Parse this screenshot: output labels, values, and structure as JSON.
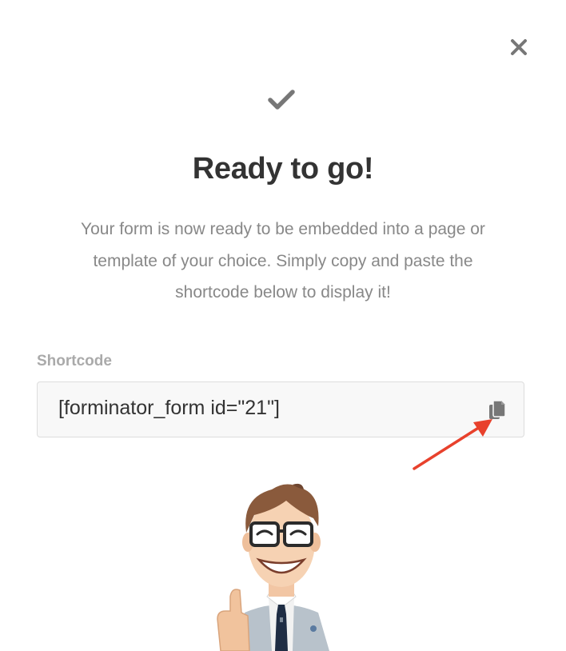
{
  "modal": {
    "title": "Ready to go!",
    "description": "Your form is now ready to be embedded into a page or template of your choice. Simply copy and paste the shortcode below to display it!",
    "close_icon": "close-icon",
    "status_icon": "checkmark-icon"
  },
  "shortcode": {
    "label": "Shortcode",
    "value": "[forminator_form id=\"21\"]",
    "copy_icon": "copy-icon"
  },
  "colors": {
    "title": "#333333",
    "description": "#888888",
    "label": "#aaaaaa",
    "arrow": "#e8412c",
    "icon": "#777777",
    "field_bg": "#f8f8f8",
    "field_border": "#dddddd"
  }
}
